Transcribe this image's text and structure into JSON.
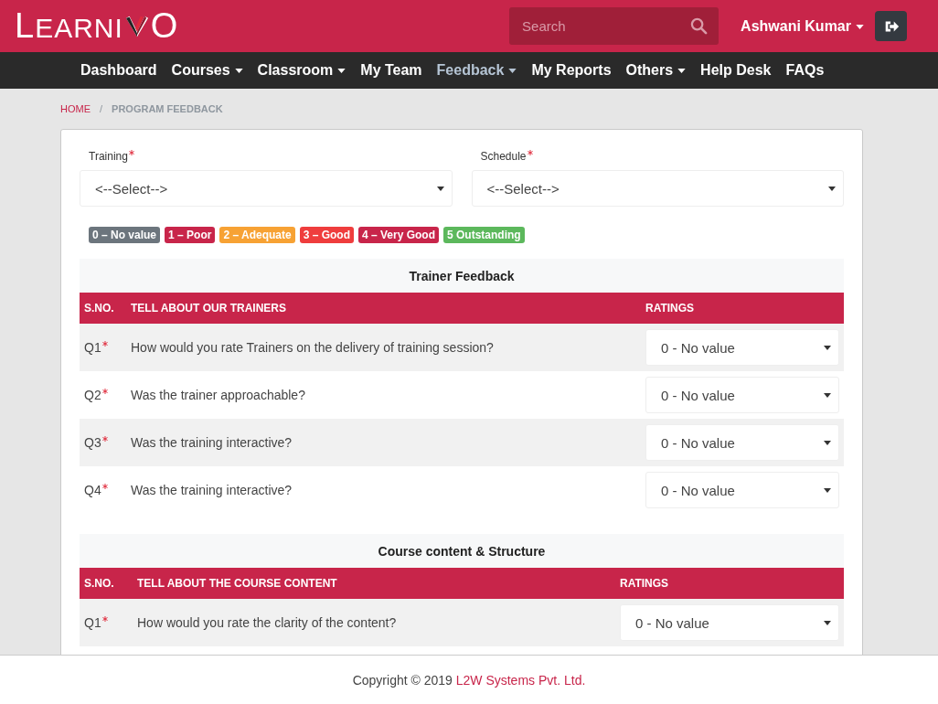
{
  "brand": {
    "left": "LEARNI",
    "right": "O"
  },
  "search": {
    "placeholder": "Search"
  },
  "user": {
    "name": "Ashwani Kumar"
  },
  "nav": [
    {
      "label": "Dashboard",
      "has_menu": false,
      "selected": false
    },
    {
      "label": "Courses",
      "has_menu": true,
      "selected": false
    },
    {
      "label": "Classroom",
      "has_menu": true,
      "selected": false
    },
    {
      "label": "My Team",
      "has_menu": false,
      "selected": false
    },
    {
      "label": "Feedback",
      "has_menu": true,
      "selected": true
    },
    {
      "label": "My Reports",
      "has_menu": false,
      "selected": false
    },
    {
      "label": "Others",
      "has_menu": true,
      "selected": false
    },
    {
      "label": "Help Desk",
      "has_menu": false,
      "selected": false
    },
    {
      "label": "FAQs",
      "has_menu": false,
      "selected": false
    }
  ],
  "breadcrumb": [
    "HOME",
    "PROGRAM FEEDBACK"
  ],
  "breadcrumb_separator": "/",
  "fields": [
    {
      "label": "Training",
      "required": true,
      "value": "<--Select-->"
    },
    {
      "label": "Schedule",
      "required": true,
      "value": "<--Select-->"
    }
  ],
  "legend": [
    {
      "label": "0 – No value",
      "color": "#6c757d"
    },
    {
      "label": "1 – Poor",
      "color": "#c8254a"
    },
    {
      "label": "2 – Adequate",
      "color": "#f7a234"
    },
    {
      "label": "3 – Good",
      "color": "#ef3d3d"
    },
    {
      "label": "4 – Very Good",
      "color": "#c8254a"
    },
    {
      "label": "5 Outstanding",
      "color": "#5cb85c"
    }
  ],
  "sections": [
    {
      "title": "Trainer Feedback",
      "columns": [
        "S.NO.",
        "TELL ABOUT OUR TRAINERS",
        "RATINGS"
      ],
      "rows": [
        {
          "no": "Q1",
          "required": true,
          "question": "How would you rate Trainers on the delivery of training session?",
          "rating": "0 - No value"
        },
        {
          "no": "Q2",
          "required": true,
          "question": "Was the trainer approachable?",
          "rating": "0 - No value"
        },
        {
          "no": "Q3",
          "required": true,
          "question": "Was the training interactive?",
          "rating": "0 - No value"
        },
        {
          "no": "Q4",
          "required": true,
          "question": "Was the training interactive?",
          "rating": "0 - No value"
        }
      ]
    },
    {
      "title": "Course content & Structure",
      "columns": [
        "S.NO.",
        "TELL ABOUT THE COURSE CONTENT",
        "RATINGS"
      ],
      "rows": [
        {
          "no": "Q1",
          "required": true,
          "question": "How would you rate the clarity of the content?",
          "rating": "0 - No value"
        }
      ]
    }
  ],
  "footer": {
    "text": "Copyright © 2019",
    "link": "L2W Systems Pvt. Ltd."
  }
}
